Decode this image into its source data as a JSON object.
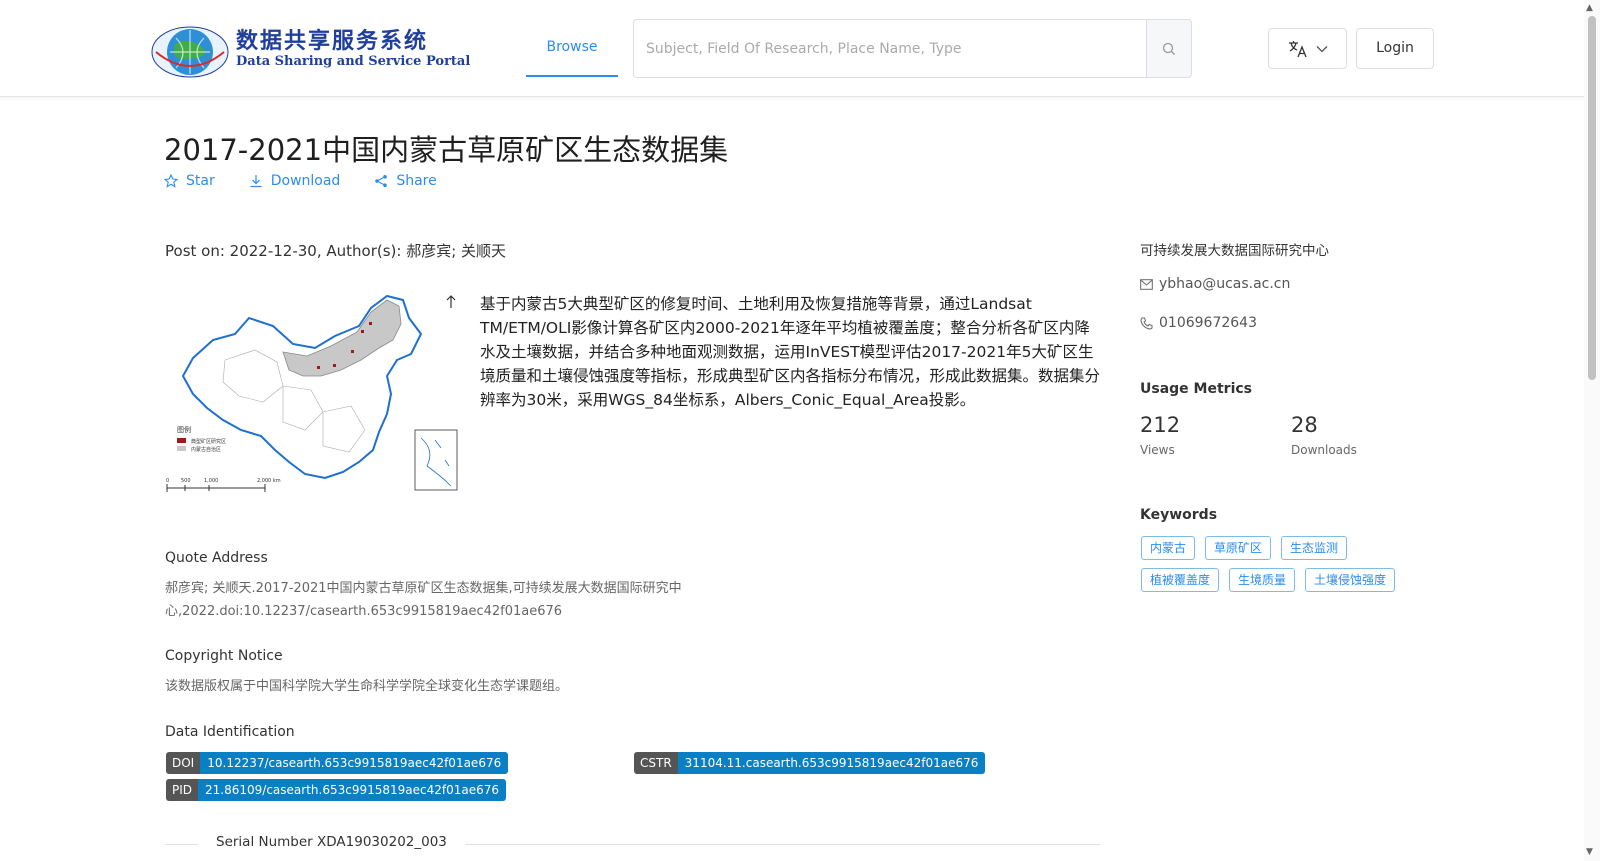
{
  "header": {
    "logo_cn": "数据共享服务系统",
    "logo_en": "Data Sharing and Service Portal",
    "nav_browse": "Browse",
    "search_placeholder": "Subject, Field Of Research, Place Name, Type",
    "login_label": "Login"
  },
  "dataset": {
    "title": "2017-2021中国内蒙古草原矿区生态数据集",
    "actions": {
      "star": "Star",
      "download": "Download",
      "share": "Share"
    },
    "post_info": "Post on: 2022-12-30, Author(s): 郝彦宾; 关顺天",
    "description": "基于内蒙古5大典型矿区的修复时间、土地利用及恢复措施等背景，通过Landsat TM/ETM/OLI影像计算各矿区内2000-2021年逐年平均植被覆盖度；整合分析各矿区内降水及土壤数据，并结合多种地面观测数据，运用InVEST模型评估2017-2021年5大矿区生境质量和土壤侵蚀强度等指标，形成典型矿区内各指标分布情况，形成此数据集。数据集分辨率为30米，采用WGS_84坐标系，Albers_Conic_Equal_Area投影。",
    "map_legend_title": "图例",
    "map_legend_items": [
      "典型矿区研究区",
      "内蒙古自治区"
    ],
    "map_scale_labels": [
      "0",
      "500",
      "1,000",
      "2,000 km"
    ]
  },
  "quote": {
    "title": "Quote Address",
    "text": "郝彦宾; 关顺天.2017-2021中国内蒙古草原矿区生态数据集,可持续发展大数据国际研究中心,2022.doi:10.12237/casearth.653c9915819aec42f01ae676"
  },
  "copyright": {
    "title": "Copyright Notice",
    "text": "该数据版权属于中国科学院大学生命科学学院全球变化生态学课题组。"
  },
  "identification": {
    "title": "Data Identification",
    "doi_key": "DOI",
    "doi_value": "10.12237/casearth.653c9915819aec42f01ae676",
    "cstr_key": "CSTR",
    "cstr_value": "31104.11.casearth.653c9915819aec42f01ae676",
    "pid_key": "PID",
    "pid_value": "21.86109/casearth.653c9915819aec42f01ae676"
  },
  "serial": "Serial Number XDA19030202_003",
  "sidebar": {
    "organization": "可持续发展大数据国际研究中心",
    "email": "ybhao@ucas.ac.cn",
    "phone": "01069672643",
    "usage_title": "Usage Metrics",
    "views_value": "212",
    "views_label": "Views",
    "downloads_value": "28",
    "downloads_label": "Downloads",
    "keywords_title": "Keywords",
    "keywords": [
      "内蒙古",
      "草原矿区",
      "生态监测",
      "植被覆盖度",
      "生境质量",
      "土壤侵蚀强度"
    ]
  },
  "colors": {
    "accent": "#2d8cf0",
    "tag_key_bg": "#555555",
    "tag_value_bg": "#0a7fc4"
  }
}
